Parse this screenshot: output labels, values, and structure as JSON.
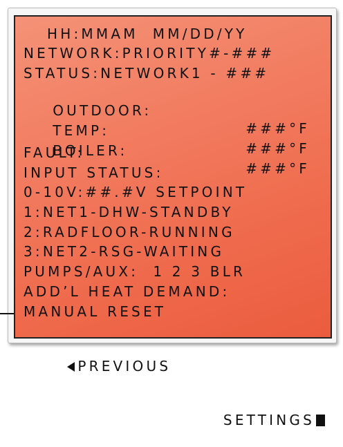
{
  "display": {
    "time_date": "HH:MMAM  MM/DD/YY",
    "network": "NETWORK:PRIORITY#-###",
    "status": "STATUS:NETWORK1 - ###",
    "outdoor_label": "OUTDOOR:",
    "outdoor_value": "###°F",
    "temp_label": "TEMP:",
    "temp_value": "###°F",
    "boiler_label": "BOILER:",
    "boiler_value": "###°F",
    "fault": "FAULT:",
    "input_status": "INPUT STATUS:",
    "input_0_10v": "0-10V:##.#V SETPOINT",
    "input_1": "1:NET1-DHW-STANDBY",
    "input_2": "2:RADFLOOR-RUNNING",
    "input_3": "3:NET2-RSG-WAITING",
    "pumps_aux": "PUMPS/AUX:  1 2 3 BLR",
    "addl_heat_demand": "ADD’L HEAT DEMAND:",
    "manual_reset": "MANUAL RESET",
    "previous": "PREVIOUS",
    "settings": "SETTINGS"
  },
  "icons": {
    "previous": "left-triangle-icon",
    "settings": "filled-square-icon",
    "pointer": "arrow-right-icon"
  },
  "colors": {
    "lcd_light": "#f49277",
    "lcd_dark": "#eb5c3e",
    "text": "#111111"
  }
}
